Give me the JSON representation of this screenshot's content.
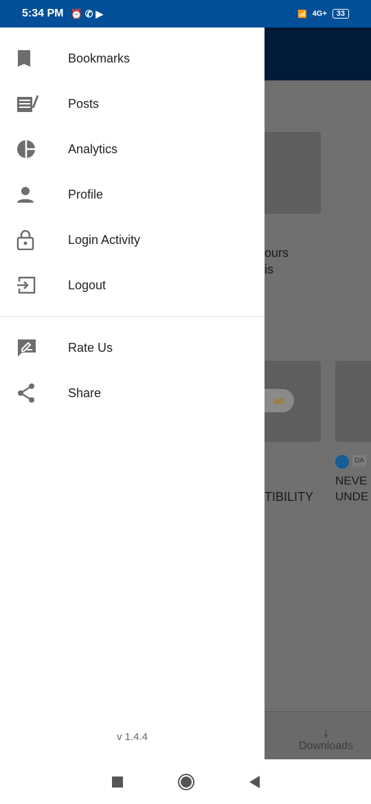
{
  "status": {
    "time": "5:34 PM",
    "battery": "33",
    "network": "4G+"
  },
  "background": {
    "snippet1": "ours",
    "snippet2": "is",
    "pill": "ad",
    "title1": "TIBILITY",
    "title2a": "NEVE",
    "title2b": "UNDE",
    "tag": "DA",
    "downloads": "Downloads"
  },
  "drawer": {
    "items": [
      {
        "label": "Bookmarks",
        "icon": "bookmark-icon"
      },
      {
        "label": "Posts",
        "icon": "posts-icon"
      },
      {
        "label": "Analytics",
        "icon": "pie-chart-icon"
      },
      {
        "label": "Profile",
        "icon": "person-icon"
      },
      {
        "label": "Login Activity",
        "icon": "lock-icon"
      },
      {
        "label": "Logout",
        "icon": "logout-icon"
      }
    ],
    "secondary": [
      {
        "label": "Rate Us",
        "icon": "rate-icon"
      },
      {
        "label": "Share",
        "icon": "share-icon"
      }
    ],
    "version": "v 1.4.4"
  },
  "colors": {
    "status_bar": "#034f98",
    "icon": "#6d6d6d"
  }
}
